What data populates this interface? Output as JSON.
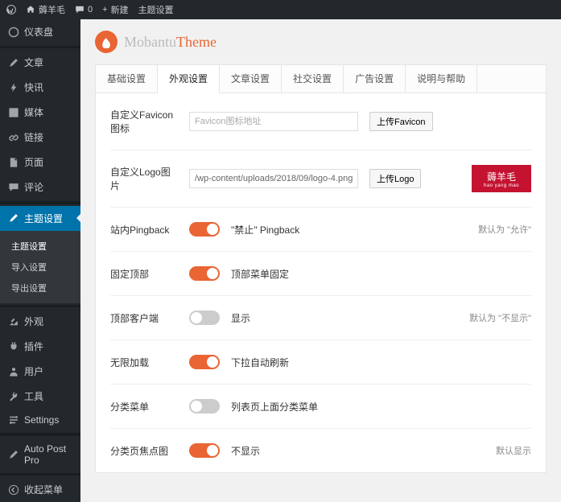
{
  "topbar": {
    "site": "薅羊毛",
    "comments": "0",
    "new": "新建",
    "theme": "主题设置"
  },
  "sidebar": {
    "items": [
      {
        "label": "仪表盘"
      },
      {
        "label": "文章"
      },
      {
        "label": "快讯"
      },
      {
        "label": "媒体"
      },
      {
        "label": "链接"
      },
      {
        "label": "页面"
      },
      {
        "label": "评论"
      }
    ],
    "active": "主题设置",
    "sub": [
      {
        "label": "主题设置"
      },
      {
        "label": "导入设置"
      },
      {
        "label": "导出设置"
      }
    ],
    "items2": [
      {
        "label": "外观"
      },
      {
        "label": "插件"
      },
      {
        "label": "用户"
      },
      {
        "label": "工具"
      },
      {
        "label": "Settings"
      }
    ],
    "items3": [
      {
        "label": "Auto Post Pro"
      }
    ],
    "collapse": "收起菜单"
  },
  "brand": {
    "grey": "Mobantu",
    "orange": "Theme"
  },
  "tabs": [
    {
      "label": "基础设置"
    },
    {
      "label": "外观设置"
    },
    {
      "label": "文章设置"
    },
    {
      "label": "社交设置"
    },
    {
      "label": "广告设置"
    },
    {
      "label": "说明与帮助"
    }
  ],
  "rows": {
    "favicon": {
      "label": "自定义Favicon图标",
      "placeholder": "Favicon图标地址",
      "btn": "上传Favicon"
    },
    "logo": {
      "label": "自定义Logo图片",
      "value": "/wp-content/uploads/2018/09/logo-4.png",
      "btn": "上传Logo",
      "prev": "薅羊毛",
      "prevSub": "hao yang mao"
    },
    "pingback": {
      "label": "站内Pingback",
      "text": "\"禁止\" Pingback",
      "note": "默认为 \"允许\""
    },
    "fixtop": {
      "label": "固定顶部",
      "text": "顶部菜单固定"
    },
    "client": {
      "label": "顶部客户端",
      "text": "显示",
      "note": "默认为 \"不显示\""
    },
    "infinite": {
      "label": "无限加载",
      "text": "下拉自动刷新"
    },
    "catmenu": {
      "label": "分类菜单",
      "text": "列表页上面分类菜单"
    },
    "focus": {
      "label": "分类页焦点图",
      "text": "不显示",
      "note": "默认显示"
    }
  }
}
